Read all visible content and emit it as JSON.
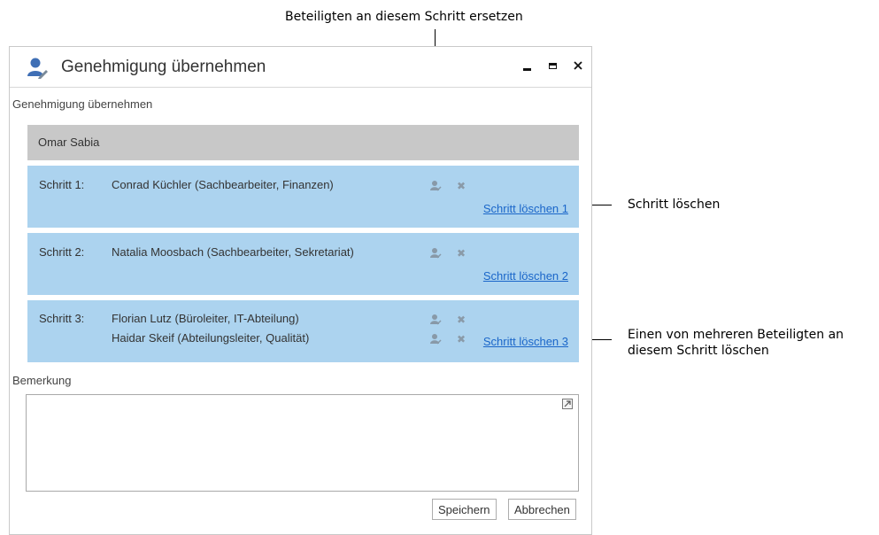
{
  "callouts": {
    "replace": "Beteiligten an diesem Schritt ersetzen",
    "delete_step": "Schritt löschen",
    "delete_participant": "Einen von mehreren Beteiligten an diesem Schritt löschen"
  },
  "dialog": {
    "title": "Genehmigung übernehmen",
    "subtitle": "Genehmigung übernehmen",
    "owner": "Omar Sabia",
    "steps": [
      {
        "label": "Schritt 1:",
        "persons": [
          "Conrad Küchler (Sachbearbeiter, Finanzen)"
        ],
        "delete_link": "Schritt löschen 1"
      },
      {
        "label": "Schritt 2:",
        "persons": [
          "Natalia Moosbach (Sachbearbeiter, Sekretariat)"
        ],
        "delete_link": "Schritt löschen 2"
      },
      {
        "label": "Schritt 3:",
        "persons": [
          "Florian Lutz (Büroleiter, IT-Abteilung)",
          "Haidar Skeif (Abteilungsleiter, Qualität)"
        ],
        "delete_link": "Schritt löschen 3"
      }
    ],
    "remark_label": "Bemerkung",
    "remark_value": "",
    "save_label": "Speichern",
    "cancel_label": "Abbrechen"
  },
  "colors": {
    "step_bg": "#acd3ef",
    "owner_bg": "#c8c8c8",
    "link": "#1a66c9",
    "icon_blue": "#3f6fb5"
  },
  "icons": [
    "user-edit-icon",
    "minimize-icon",
    "maximize-icon",
    "close-icon",
    "replace-participant-icon",
    "remove-participant-icon",
    "expand-icon"
  ]
}
